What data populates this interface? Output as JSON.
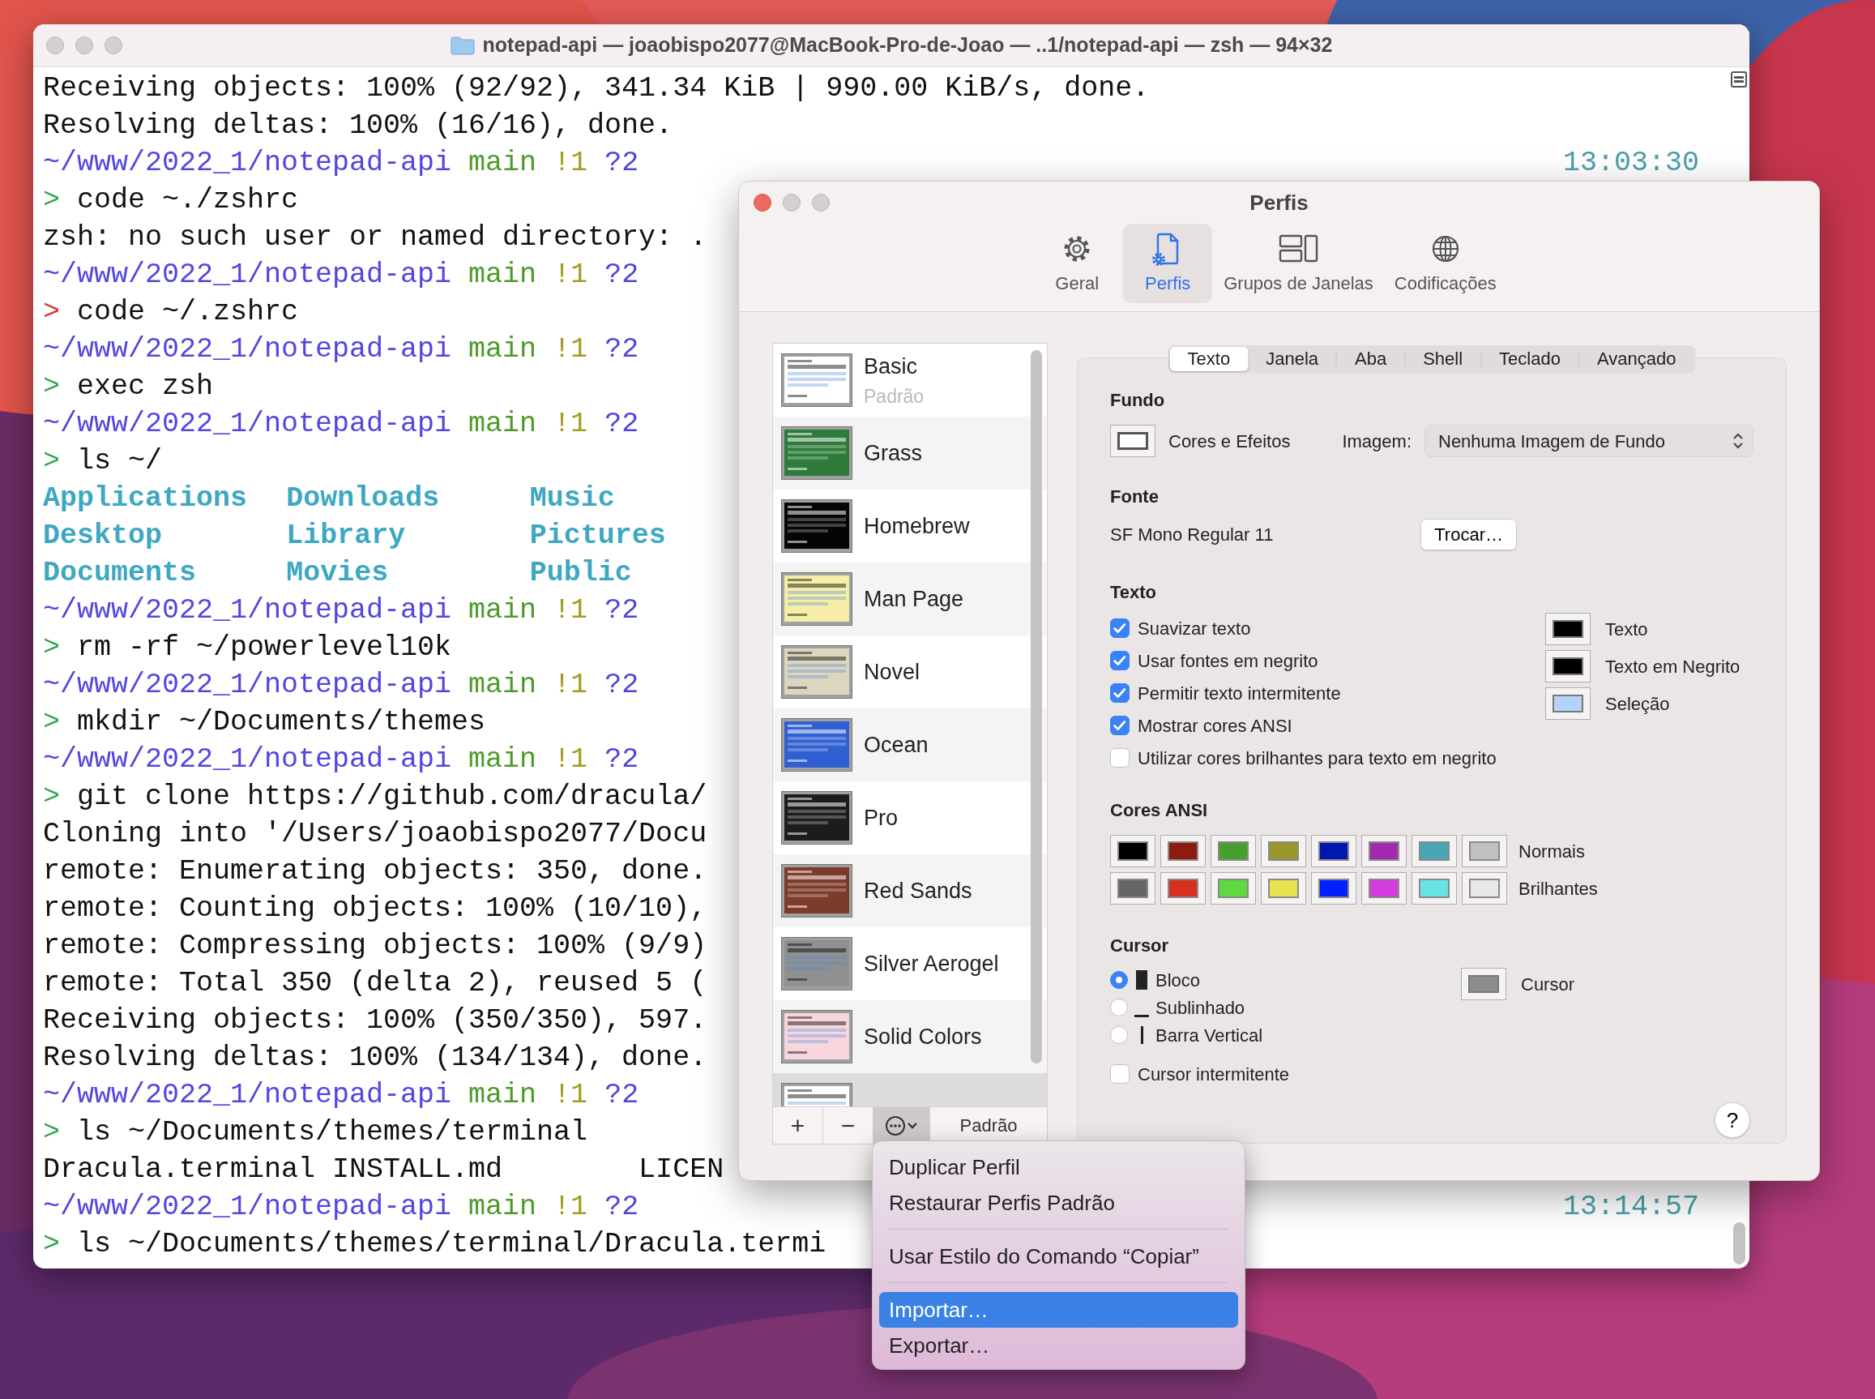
{
  "terminal": {
    "title": "notepad-api — joaobispo2077@MacBook-Pro-de-Joao — ..1/notepad-api — zsh — 94×32",
    "lines": [
      {
        "kind": "output",
        "text": "Receiving objects: 100% (92/92), 341.34 KiB | 990.00 KiB/s, done."
      },
      {
        "kind": "output",
        "text": "Resolving deltas: 100% (16/16), done."
      },
      {
        "kind": "prompt",
        "path": "~/www/2022_1/notepad-api",
        "branch": "main",
        "flags": [
          {
            "text": "!1",
            "color": "#a39d1e"
          },
          {
            "text": "?2",
            "color": "#4e45dc"
          }
        ],
        "time": "13:03:30"
      },
      {
        "kind": "command",
        "symbol": ">",
        "failed": false,
        "text": "code ~./zshrc"
      },
      {
        "kind": "output",
        "text": "zsh: no such user or named directory: ."
      },
      {
        "kind": "prompt",
        "path": "~/www/2022_1/notepad-api",
        "branch": "main",
        "flags": [
          {
            "text": "!1",
            "color": "#a39d1e"
          },
          {
            "text": "?2",
            "color": "#4e45dc"
          }
        ]
      },
      {
        "kind": "command",
        "symbol": ">",
        "failed": true,
        "text": "code ~/.zshrc"
      },
      {
        "kind": "prompt",
        "path": "~/www/2022_1/notepad-api",
        "branch": "main",
        "flags": [
          {
            "text": "!1",
            "color": "#a39d1e"
          },
          {
            "text": "?2",
            "color": "#4e45dc"
          }
        ]
      },
      {
        "kind": "command",
        "symbol": ">",
        "failed": false,
        "text": "exec zsh"
      },
      {
        "kind": "prompt",
        "path": "~/www/2022_1/notepad-api",
        "branch": "main",
        "flags": [
          {
            "text": "!1",
            "color": "#a39d1e"
          },
          {
            "text": "?2",
            "color": "#4e45dc"
          }
        ]
      },
      {
        "kind": "command",
        "symbol": ">",
        "failed": false,
        "text": "ls ~/"
      },
      {
        "kind": "listing",
        "cells": [
          "Applications",
          "Downloads",
          "Music"
        ]
      },
      {
        "kind": "listing",
        "cells": [
          "Desktop",
          "Library",
          "Pictures"
        ]
      },
      {
        "kind": "listing",
        "cells": [
          "Documents",
          "Movies",
          "Public"
        ]
      },
      {
        "kind": "prompt",
        "path": "~/www/2022_1/notepad-api",
        "branch": "main",
        "flags": [
          {
            "text": "!1",
            "color": "#a39d1e"
          },
          {
            "text": "?2",
            "color": "#4e45dc"
          }
        ]
      },
      {
        "kind": "command",
        "symbol": ">",
        "failed": false,
        "text": "rm -rf ~/powerlevel10k"
      },
      {
        "kind": "prompt",
        "path": "~/www/2022_1/notepad-api",
        "branch": "main",
        "flags": [
          {
            "text": "!1",
            "color": "#a39d1e"
          },
          {
            "text": "?2",
            "color": "#4e45dc"
          }
        ]
      },
      {
        "kind": "command",
        "symbol": ">",
        "failed": false,
        "text": "mkdir ~/Documents/themes"
      },
      {
        "kind": "prompt",
        "path": "~/www/2022_1/notepad-api",
        "branch": "main",
        "flags": [
          {
            "text": "!1",
            "color": "#a39d1e"
          },
          {
            "text": "?2",
            "color": "#4e45dc"
          }
        ]
      },
      {
        "kind": "command",
        "symbol": ">",
        "failed": false,
        "text": "git clone https://github.com/dracula/"
      },
      {
        "kind": "output",
        "text": "Cloning into '/Users/joaobispo2077/Docu"
      },
      {
        "kind": "output",
        "text": "remote: Enumerating objects: 350, done."
      },
      {
        "kind": "output",
        "text": "remote: Counting objects: 100% (10/10),"
      },
      {
        "kind": "output",
        "text": "remote: Compressing objects: 100% (9/9)"
      },
      {
        "kind": "output",
        "text": "remote: Total 350 (delta 2), reused 5 ("
      },
      {
        "kind": "output",
        "text": "Receiving objects: 100% (350/350), 597."
      },
      {
        "kind": "output",
        "text": "Resolving deltas: 100% (134/134), done."
      },
      {
        "kind": "prompt",
        "path": "~/www/2022_1/notepad-api",
        "branch": "main",
        "flags": [
          {
            "text": "!1",
            "color": "#a39d1e"
          },
          {
            "text": "?2",
            "color": "#4e45dc"
          }
        ]
      },
      {
        "kind": "command",
        "symbol": ">",
        "failed": false,
        "text": "ls ~/Documents/themes/terminal"
      },
      {
        "kind": "output",
        "text": "Dracula.terminal INSTALL.md        LICEN"
      },
      {
        "kind": "prompt",
        "path": "~/www/2022_1/notepad-api",
        "branch": "main",
        "flags": [
          {
            "text": "!1",
            "color": "#a39d1e"
          },
          {
            "text": "?2",
            "color": "#4e45dc"
          }
        ],
        "time": "13:14:57"
      },
      {
        "kind": "command",
        "symbol": ">",
        "failed": false,
        "text": "ls ~/Documents/themes/terminal/Dracula.termi"
      }
    ]
  },
  "preferences": {
    "title": "Perfis",
    "toolbar": [
      {
        "label": "Geral",
        "kind": "gear",
        "selected": false
      },
      {
        "label": "Perfis",
        "kind": "profile",
        "selected": true
      },
      {
        "label": "Grupos de Janelas",
        "kind": "windows",
        "selected": false
      },
      {
        "label": "Codificações",
        "kind": "globe",
        "selected": false
      }
    ],
    "profiles": [
      {
        "name": "Basic",
        "subtitle": "Padrão",
        "color": "#ffffff",
        "selected": false
      },
      {
        "name": "Grass",
        "color": "#2f7b3c",
        "selected": false
      },
      {
        "name": "Homebrew",
        "color": "#050505",
        "selected": false
      },
      {
        "name": "Man Page",
        "color": "#f6eea6",
        "selected": false
      },
      {
        "name": "Novel",
        "color": "#ddd6be",
        "selected": false
      },
      {
        "name": "Ocean",
        "color": "#2f5fd0",
        "selected": false
      },
      {
        "name": "Pro",
        "color": "#1c1c1c",
        "selected": false
      },
      {
        "name": "Red Sands",
        "color": "#7d3b2c",
        "selected": false
      },
      {
        "name": "Silver Aerogel",
        "color": "#909090",
        "selected": false
      },
      {
        "name": "Solid Colors",
        "color": "#f7d7dd",
        "selected": false
      },
      {
        "color": "#ffffff",
        "selected": true
      }
    ],
    "list_buttons": [
      {
        "kind": "text",
        "label": "+"
      },
      {
        "kind": "text",
        "label": "−"
      },
      {
        "kind": "menu",
        "pressed": true
      },
      {
        "kind": "text",
        "label": "Padrão"
      }
    ],
    "tabs": [
      {
        "label": "Texto",
        "selected": true
      },
      {
        "label": "Janela",
        "selected": false
      },
      {
        "label": "Aba",
        "selected": false
      },
      {
        "label": "Shell",
        "selected": false
      },
      {
        "label": "Teclado",
        "selected": false
      },
      {
        "label": "Avançado",
        "selected": false
      }
    ],
    "background": {
      "heading": "Fundo",
      "swatch_label": "Cores e Efeitos",
      "image_label": "Imagem:",
      "image_value": "Nenhuma Imagem de Fundo"
    },
    "font": {
      "heading": "Fonte",
      "name": "SF Mono Regular 11",
      "button": "Trocar…"
    },
    "text": {
      "heading": "Texto",
      "options": [
        {
          "label": "Suavizar texto",
          "checked": true
        },
        {
          "label": "Usar fontes em negrito",
          "checked": true
        },
        {
          "label": "Permitir texto intermitente",
          "checked": true
        },
        {
          "label": "Mostrar cores ANSI",
          "checked": true
        },
        {
          "label": "Utilizar cores brilhantes para texto em negrito",
          "checked": false
        }
      ],
      "colors": [
        {
          "label": "Texto",
          "color": "#000000"
        },
        {
          "label": "Texto em Negrito",
          "color": "#000000"
        },
        {
          "label": "Seleção",
          "color": "#b3d4f8"
        }
      ]
    },
    "ansi": {
      "heading": "Cores ANSI",
      "rows": [
        {
          "label": "Normais",
          "colors": [
            {
              "color": "#000000"
            },
            {
              "color": "#8c1b12"
            },
            {
              "color": "#47a02e"
            },
            {
              "color": "#9a962c"
            },
            {
              "color": "#0018b0"
            },
            {
              "color": "#a32ab0"
            },
            {
              "color": "#4aa6b5"
            },
            {
              "color": "#c0c0c0"
            }
          ]
        },
        {
          "label": "Brilhantes",
          "colors": [
            {
              "color": "#666666"
            },
            {
              "color": "#d63020"
            },
            {
              "color": "#60d840"
            },
            {
              "color": "#e8e24c"
            },
            {
              "color": "#0021fe"
            },
            {
              "color": "#d43ce0"
            },
            {
              "color": "#66e3e3"
            },
            {
              "color": "#e8e8e8"
            }
          ]
        }
      ]
    },
    "cursor": {
      "heading": "Cursor",
      "styles": [
        {
          "label": "Bloco",
          "kind": "block",
          "selected": true
        },
        {
          "label": "Sublinhado",
          "kind": "underline",
          "selected": false
        },
        {
          "label": "Barra Vertical",
          "kind": "bar",
          "selected": false
        }
      ],
      "color": {
        "label": "Cursor",
        "color": "#8e8e8e"
      },
      "blink": {
        "label": "Cursor intermitente",
        "checked": false
      }
    },
    "help": "?"
  },
  "menu": {
    "items": [
      {
        "kind": "item",
        "label": "Duplicar Perfil",
        "selected": false
      },
      {
        "kind": "item",
        "label": "Restaurar Perfis Padrão",
        "selected": false
      },
      {
        "kind": "separator"
      },
      {
        "kind": "item",
        "label": "Usar Estilo do Comando “Copiar”",
        "selected": false
      },
      {
        "kind": "separator"
      },
      {
        "kind": "item",
        "label": "Importar…",
        "selected": true
      },
      {
        "kind": "item",
        "label": "Exportar…",
        "selected": false
      }
    ]
  }
}
